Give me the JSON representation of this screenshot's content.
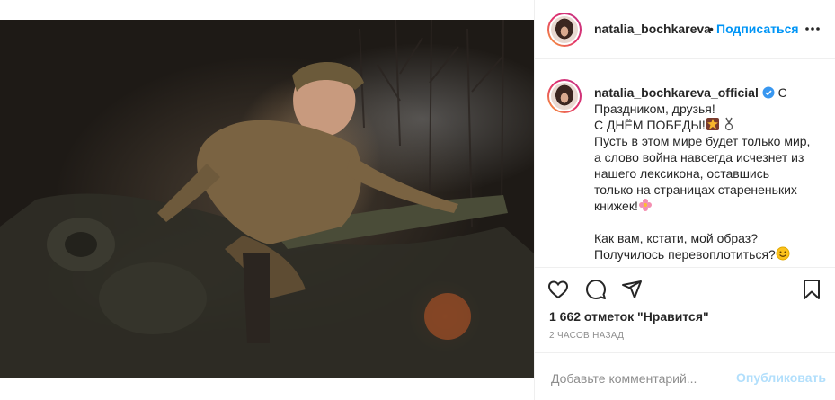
{
  "header": {
    "username": "natalia_bochkareva",
    "separator": "•",
    "follow_label": "Подписаться",
    "more_icon": "more-dots-icon"
  },
  "caption": {
    "username": "natalia_bochkareva_official",
    "verified_icon": "verified-badge-icon",
    "lines": [
      "С",
      "Праздником, друзья!",
      "С ДНЁМ ПОБЕДЫ!",
      "Пусть в этом мире будет только мир,",
      "а слово война навсегда исчезнет из",
      "нашего лексикона, оставшись",
      "только на страницах старененьких",
      "книжек!",
      "",
      "Как вам, кстати, мой образ?",
      "Получилось перевоплотиться?"
    ],
    "emojis": [
      "collision-emoji",
      "medal-emoji",
      "flower-emoji",
      "smile-emoji"
    ]
  },
  "actions": {
    "like_icon": "heart-icon",
    "comment_icon": "comment-icon",
    "share_icon": "share-icon",
    "save_icon": "bookmark-icon"
  },
  "likes_text": "1 662 отметок \"Нравится\"",
  "time_text": "2 часов назад",
  "comment": {
    "placeholder": "Добавьте комментарий...",
    "value": "",
    "publish_label": "Опубликовать"
  },
  "colors": {
    "accent": "#0095f6",
    "publish_disabled": "#b2dffc",
    "muted": "#8e8e8e",
    "text": "#262626"
  }
}
